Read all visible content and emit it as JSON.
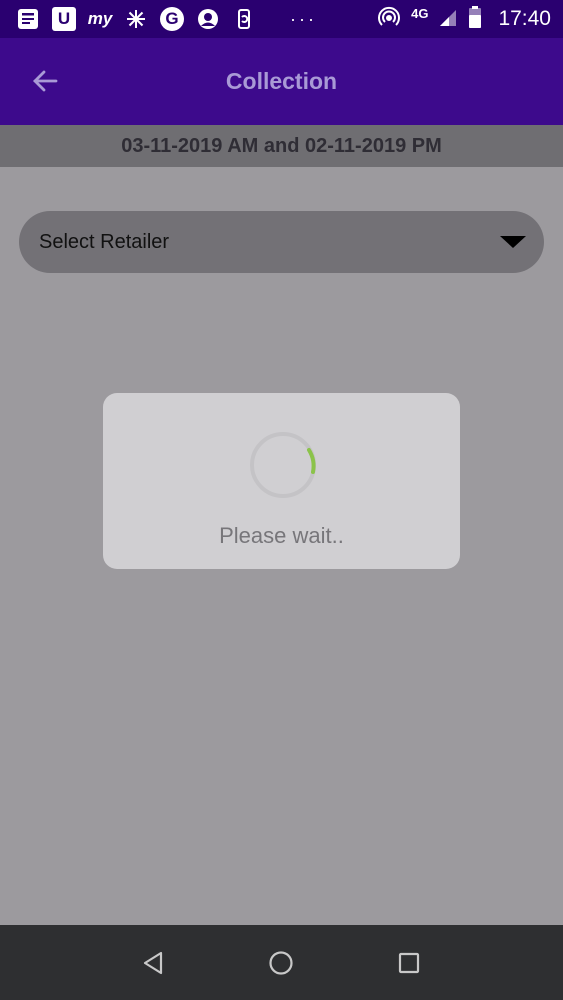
{
  "status_bar": {
    "icons": [
      "news-icon",
      "u-app-icon",
      "my-app-icon",
      "asterisk-app-icon",
      "google-icon",
      "avatar-app-icon",
      "phone-sync-icon"
    ],
    "u_glyph": "U",
    "my_glyph": "my",
    "g_glyph": "G",
    "more": "···",
    "network": "4G",
    "time": "17:40"
  },
  "app_bar": {
    "title": "Collection",
    "back_icon": "arrow-back-icon"
  },
  "date_range": "03-11-2019 AM and 02-11-2019 PM",
  "retailer_select": {
    "placeholder": "Select Retailer",
    "icon": "caret-down-icon"
  },
  "progress_dialog": {
    "message": "Please wait..",
    "spinner_color": "#8bc34a"
  },
  "nav_bar": {
    "buttons": [
      "back-triangle-icon",
      "home-circle-icon",
      "recents-square-icon"
    ]
  },
  "colors": {
    "status_bar": "#2a0070",
    "app_bar": "#3d0a8c",
    "title": "#a99ad6",
    "overlay": "#9c9a9e"
  }
}
